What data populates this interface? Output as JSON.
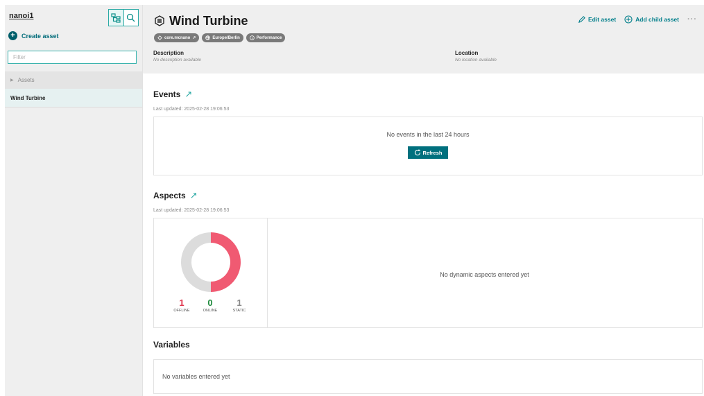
{
  "sidebar": {
    "tenant": "nanoi1",
    "create_label": "Create asset",
    "filter_placeholder": "Filter",
    "tree_root": "Assets",
    "tree_item": "Wind Turbine"
  },
  "header": {
    "title": "Wind Turbine",
    "chips": [
      "core.mcnano",
      "Europe/Berlin",
      "Performance"
    ],
    "description_label": "Description",
    "description_value": "No description available",
    "location_label": "Location",
    "location_value": "No location available",
    "edit_label": "Edit asset",
    "add_child_label": "Add child asset"
  },
  "events": {
    "title": "Events",
    "updated": "Last updated: 2025-02-28 19:06:53",
    "empty": "No events in the last 24 hours",
    "refresh": "Refresh"
  },
  "aspects": {
    "title": "Aspects",
    "updated": "Last updated: 2025-02-28 19:06:53",
    "empty": "No dynamic aspects entered yet",
    "stats": [
      {
        "value": "1",
        "label": "OFFLINE",
        "color": "#e0344c"
      },
      {
        "value": "0",
        "label": "ONLINE",
        "color": "#1e8a3c"
      },
      {
        "value": "1",
        "label": "STATIC",
        "color": "#8a8a8a"
      }
    ],
    "donut": {
      "offline": 1,
      "online": 0,
      "static": 1,
      "offline_color": "#f05a72",
      "static_color": "#dcdcdc"
    }
  },
  "variables": {
    "title": "Variables",
    "empty": "No variables entered yet"
  }
}
